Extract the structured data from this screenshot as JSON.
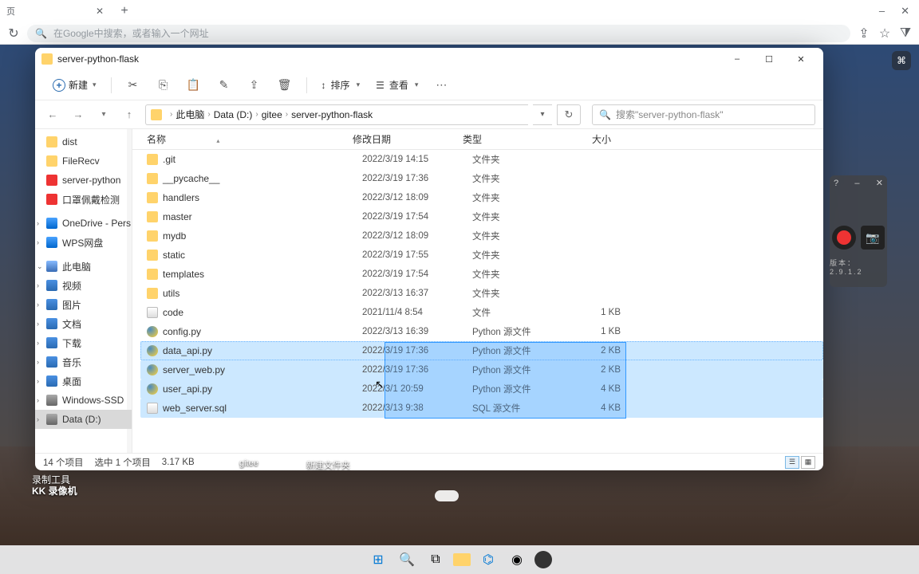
{
  "browser": {
    "tab_label": "页",
    "addr_placeholder": "在Google中搜索，或者输入一个网址"
  },
  "explorer": {
    "title": "server-python-flask",
    "toolbar": {
      "new_label": "新建",
      "sort_label": "排序",
      "view_label": "查看"
    },
    "breadcrumb": {
      "p1": "此电脑",
      "p2": "Data (D:)",
      "p3": "gitee",
      "p4": "server-python-flask"
    },
    "search_placeholder": "搜索\"server-python-flask\"",
    "sidebar": {
      "items": [
        {
          "label": "dist",
          "icon": "folder"
        },
        {
          "label": "FileRecv",
          "icon": "folder"
        },
        {
          "label": "server-python",
          "icon": "red"
        },
        {
          "label": "口罩佩戴检测",
          "icon": "red"
        },
        {
          "label": "OneDrive - Pers",
          "icon": "cloud",
          "expand": ">"
        },
        {
          "label": "WPS网盘",
          "icon": "cloud",
          "expand": ">"
        },
        {
          "label": "此电脑",
          "icon": "pc",
          "expand": "v"
        },
        {
          "label": "视频",
          "icon": "media",
          "expand": ">"
        },
        {
          "label": "图片",
          "icon": "media",
          "expand": ">"
        },
        {
          "label": "文档",
          "icon": "media",
          "expand": ">"
        },
        {
          "label": "下载",
          "icon": "media",
          "expand": ">"
        },
        {
          "label": "音乐",
          "icon": "media",
          "expand": ">"
        },
        {
          "label": "桌面",
          "icon": "media",
          "expand": ">"
        },
        {
          "label": "Windows-SSD",
          "icon": "drive",
          "expand": ">"
        },
        {
          "label": "Data (D:)",
          "icon": "drive",
          "expand": ">",
          "sel": true
        }
      ]
    },
    "columns": {
      "name": "名称",
      "date": "修改日期",
      "type": "类型",
      "size": "大小"
    },
    "files": [
      {
        "name": ".git",
        "date": "2022/3/19 14:15",
        "type": "文件夹",
        "size": "",
        "icon": "folder"
      },
      {
        "name": "__pycache__",
        "date": "2022/3/19 17:36",
        "type": "文件夹",
        "size": "",
        "icon": "folder"
      },
      {
        "name": "handlers",
        "date": "2022/3/12 18:09",
        "type": "文件夹",
        "size": "",
        "icon": "folder"
      },
      {
        "name": "master",
        "date": "2022/3/19 17:54",
        "type": "文件夹",
        "size": "",
        "icon": "folder"
      },
      {
        "name": "mydb",
        "date": "2022/3/12 18:09",
        "type": "文件夹",
        "size": "",
        "icon": "folder"
      },
      {
        "name": "static",
        "date": "2022/3/19 17:55",
        "type": "文件夹",
        "size": "",
        "icon": "folder"
      },
      {
        "name": "templates",
        "date": "2022/3/19 17:54",
        "type": "文件夹",
        "size": "",
        "icon": "folder"
      },
      {
        "name": "utils",
        "date": "2022/3/13 16:37",
        "type": "文件夹",
        "size": "",
        "icon": "folder"
      },
      {
        "name": "code",
        "date": "2021/11/4 8:54",
        "type": "文件",
        "size": "1 KB",
        "icon": "code"
      },
      {
        "name": "config.py",
        "date": "2022/3/13 16:39",
        "type": "Python 源文件",
        "size": "1 KB",
        "icon": "py"
      },
      {
        "name": "data_api.py",
        "date": "2022/3/19 17:36",
        "type": "Python 源文件",
        "size": "2 KB",
        "icon": "py",
        "hl": true,
        "sel": true
      },
      {
        "name": "server_web.py",
        "date": "2022/3/19 17:36",
        "type": "Python 源文件",
        "size": "2 KB",
        "icon": "py",
        "hl": true
      },
      {
        "name": "user_api.py",
        "date": "2022/3/1 20:59",
        "type": "Python 源文件",
        "size": "4 KB",
        "icon": "py",
        "hl": true
      },
      {
        "name": "web_server.sql",
        "date": "2022/3/13 9:38",
        "type": "SQL 源文件",
        "size": "4 KB",
        "icon": "sql",
        "hl": true
      }
    ],
    "status": {
      "items": "14 个项目",
      "selected": "选中 1 个项目",
      "size": "3.17 KB"
    }
  },
  "rec": {
    "version": "版本：2.9.1.2"
  },
  "desktop": {
    "label1": "录制工具",
    "label2": "KK 录像机",
    "icon1": "gitee",
    "icon2": "新建文件夹"
  }
}
